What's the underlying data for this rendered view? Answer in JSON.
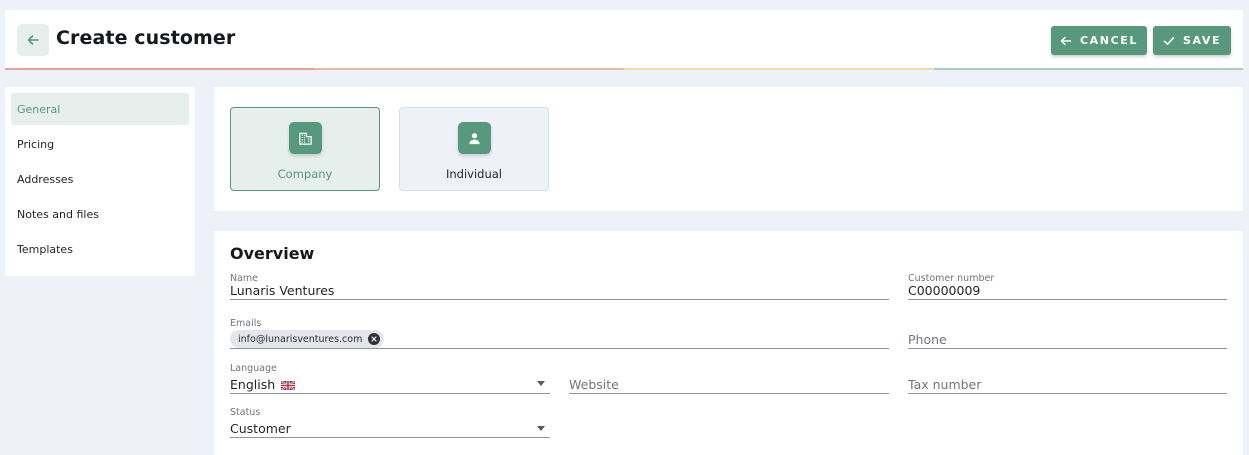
{
  "header": {
    "title": "Create customer",
    "cancel_label": "CANCEL",
    "save_label": "SAVE"
  },
  "sidebar": {
    "items": [
      {
        "label": "General",
        "active": true
      },
      {
        "label": "Pricing"
      },
      {
        "label": "Addresses"
      },
      {
        "label": "Notes and files"
      },
      {
        "label": "Templates"
      }
    ]
  },
  "customer_type": {
    "selected": "Company",
    "options": [
      {
        "label": "Company",
        "icon": "building-icon"
      },
      {
        "label": "Individual",
        "icon": "person-icon"
      }
    ]
  },
  "overview": {
    "title": "Overview",
    "name": {
      "label": "Name",
      "value": "Lunaris Ventures"
    },
    "customer_number": {
      "label": "Customer number",
      "value": "C00000009"
    },
    "emails": {
      "label": "Emails",
      "chips": [
        "info@lunarisventures.com"
      ]
    },
    "phone": {
      "placeholder": "Phone"
    },
    "language": {
      "label": "Language",
      "value": "English",
      "flag": "uk-flag-icon"
    },
    "website": {
      "placeholder": "Website"
    },
    "tax_number": {
      "placeholder": "Tax number"
    },
    "status": {
      "label": "Status",
      "value": "Customer"
    }
  },
  "colors": {
    "accent": "#57987f",
    "accent_light": "#e6efec",
    "page_bg": "#eef1f8",
    "rainbow": [
      "#e5a299",
      "#eab8a0",
      "#efdba6",
      "#a9cfc2"
    ]
  }
}
